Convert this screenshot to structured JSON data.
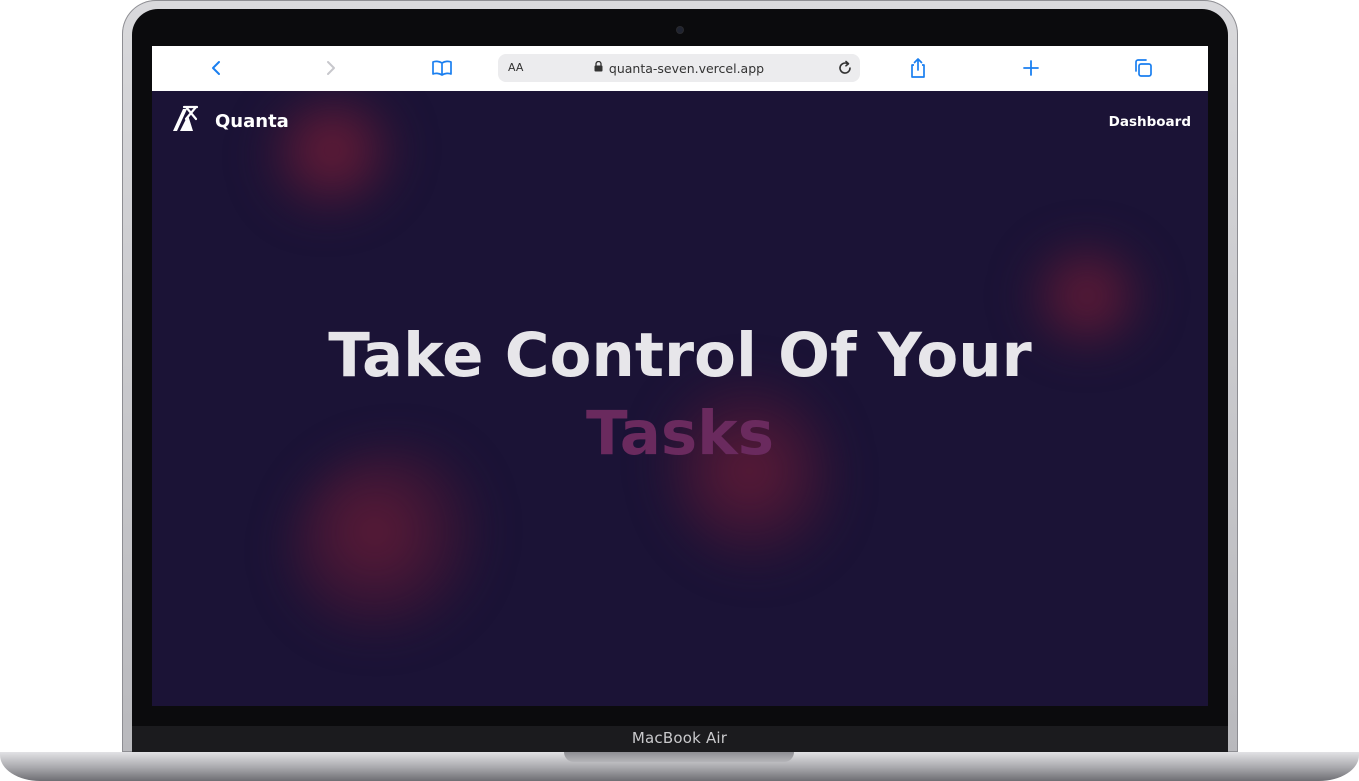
{
  "device": {
    "label": "MacBook Air"
  },
  "browser": {
    "text_size_label": "AA",
    "url": "quanta-seven.vercel.app",
    "icons": {
      "back": "chevron-left-icon",
      "forward": "chevron-right-icon",
      "bookmarks": "book-icon",
      "lock": "lock-icon",
      "reload": "reload-icon",
      "share": "share-icon",
      "new_tab": "plus-icon",
      "tabs": "tabs-icon"
    },
    "accent_color": "#1a7ff0"
  },
  "site": {
    "brand_name": "Quanta",
    "logo_icon": "quanta-logo-icon",
    "nav": {
      "dashboard_label": "Dashboard"
    },
    "hero": {
      "line1": "Take Control Of Your",
      "line2": "Tasks"
    },
    "colors": {
      "background": "#1b1336",
      "hero_text": "#e7e6ea",
      "accent_text": "#6a2a5e",
      "blob": "#7a1e38"
    }
  }
}
